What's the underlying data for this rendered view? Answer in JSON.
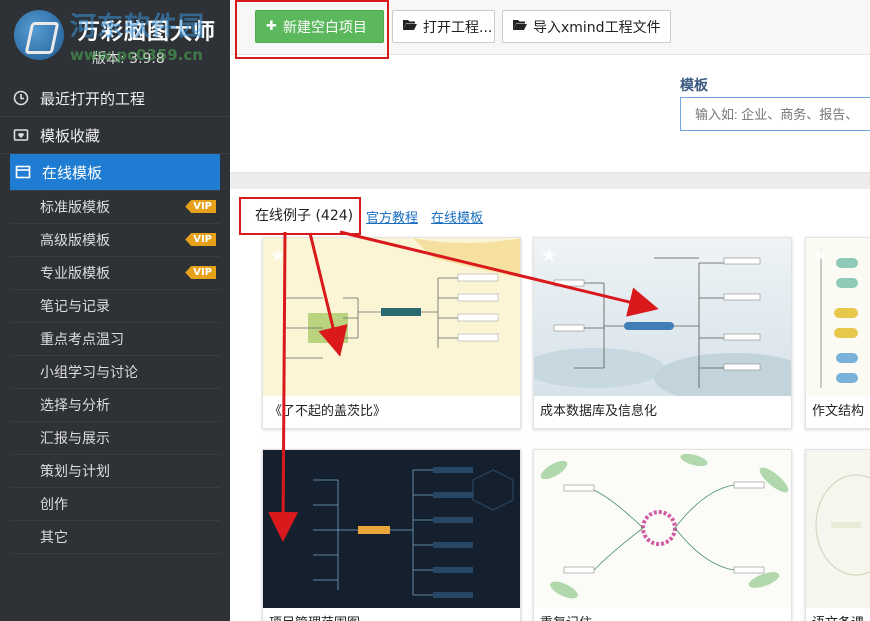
{
  "app": {
    "name": "万彩脑图大师",
    "version": "版本: 3.9.8",
    "watermark": "河东软件园",
    "watermark_url": "www.pc0359.cn"
  },
  "sidebar": {
    "main_items": [
      {
        "label": "最近打开的工程",
        "icon": "clock-icon"
      },
      {
        "label": "模板收藏",
        "icon": "heart-folder-icon"
      },
      {
        "label": "在线模板",
        "icon": "template-icon",
        "active": true
      }
    ],
    "sub_items": [
      {
        "label": "标准版模板",
        "vip": "VIP"
      },
      {
        "label": "高级版模板",
        "vip": "VIP"
      },
      {
        "label": "专业版模板",
        "vip": "VIP"
      },
      {
        "label": "笔记与记录"
      },
      {
        "label": "重点考点温习"
      },
      {
        "label": "小组学习与讨论"
      },
      {
        "label": "选择与分析"
      },
      {
        "label": "汇报与展示"
      },
      {
        "label": "策划与计划"
      },
      {
        "label": "创作"
      },
      {
        "label": "其它"
      }
    ]
  },
  "toolbar": {
    "new_label": "新建空白项目",
    "open_label": "打开工程...",
    "import_label": "导入xmind工程文件"
  },
  "search": {
    "label": "模板",
    "placeholder": "输入如: 企业、商务、报告、"
  },
  "content": {
    "examples_label": "在线例子 (424)",
    "link_official": "官方教程",
    "link_online": "在线模板"
  },
  "cards": [
    {
      "title": "《了不起的盖茨比》"
    },
    {
      "title": "成本数据库及信息化"
    },
    {
      "title": "作文结构"
    },
    {
      "title": "项目管理范围图"
    },
    {
      "title": "重复记住"
    },
    {
      "title": "语文备课"
    }
  ],
  "colors": {
    "sidebar_bg": "#2e3135",
    "active_blue": "#1e7cd2",
    "green_button": "#5cb85c",
    "vip_orange": "#e5a11a",
    "annotation_red": "#d9191c"
  }
}
